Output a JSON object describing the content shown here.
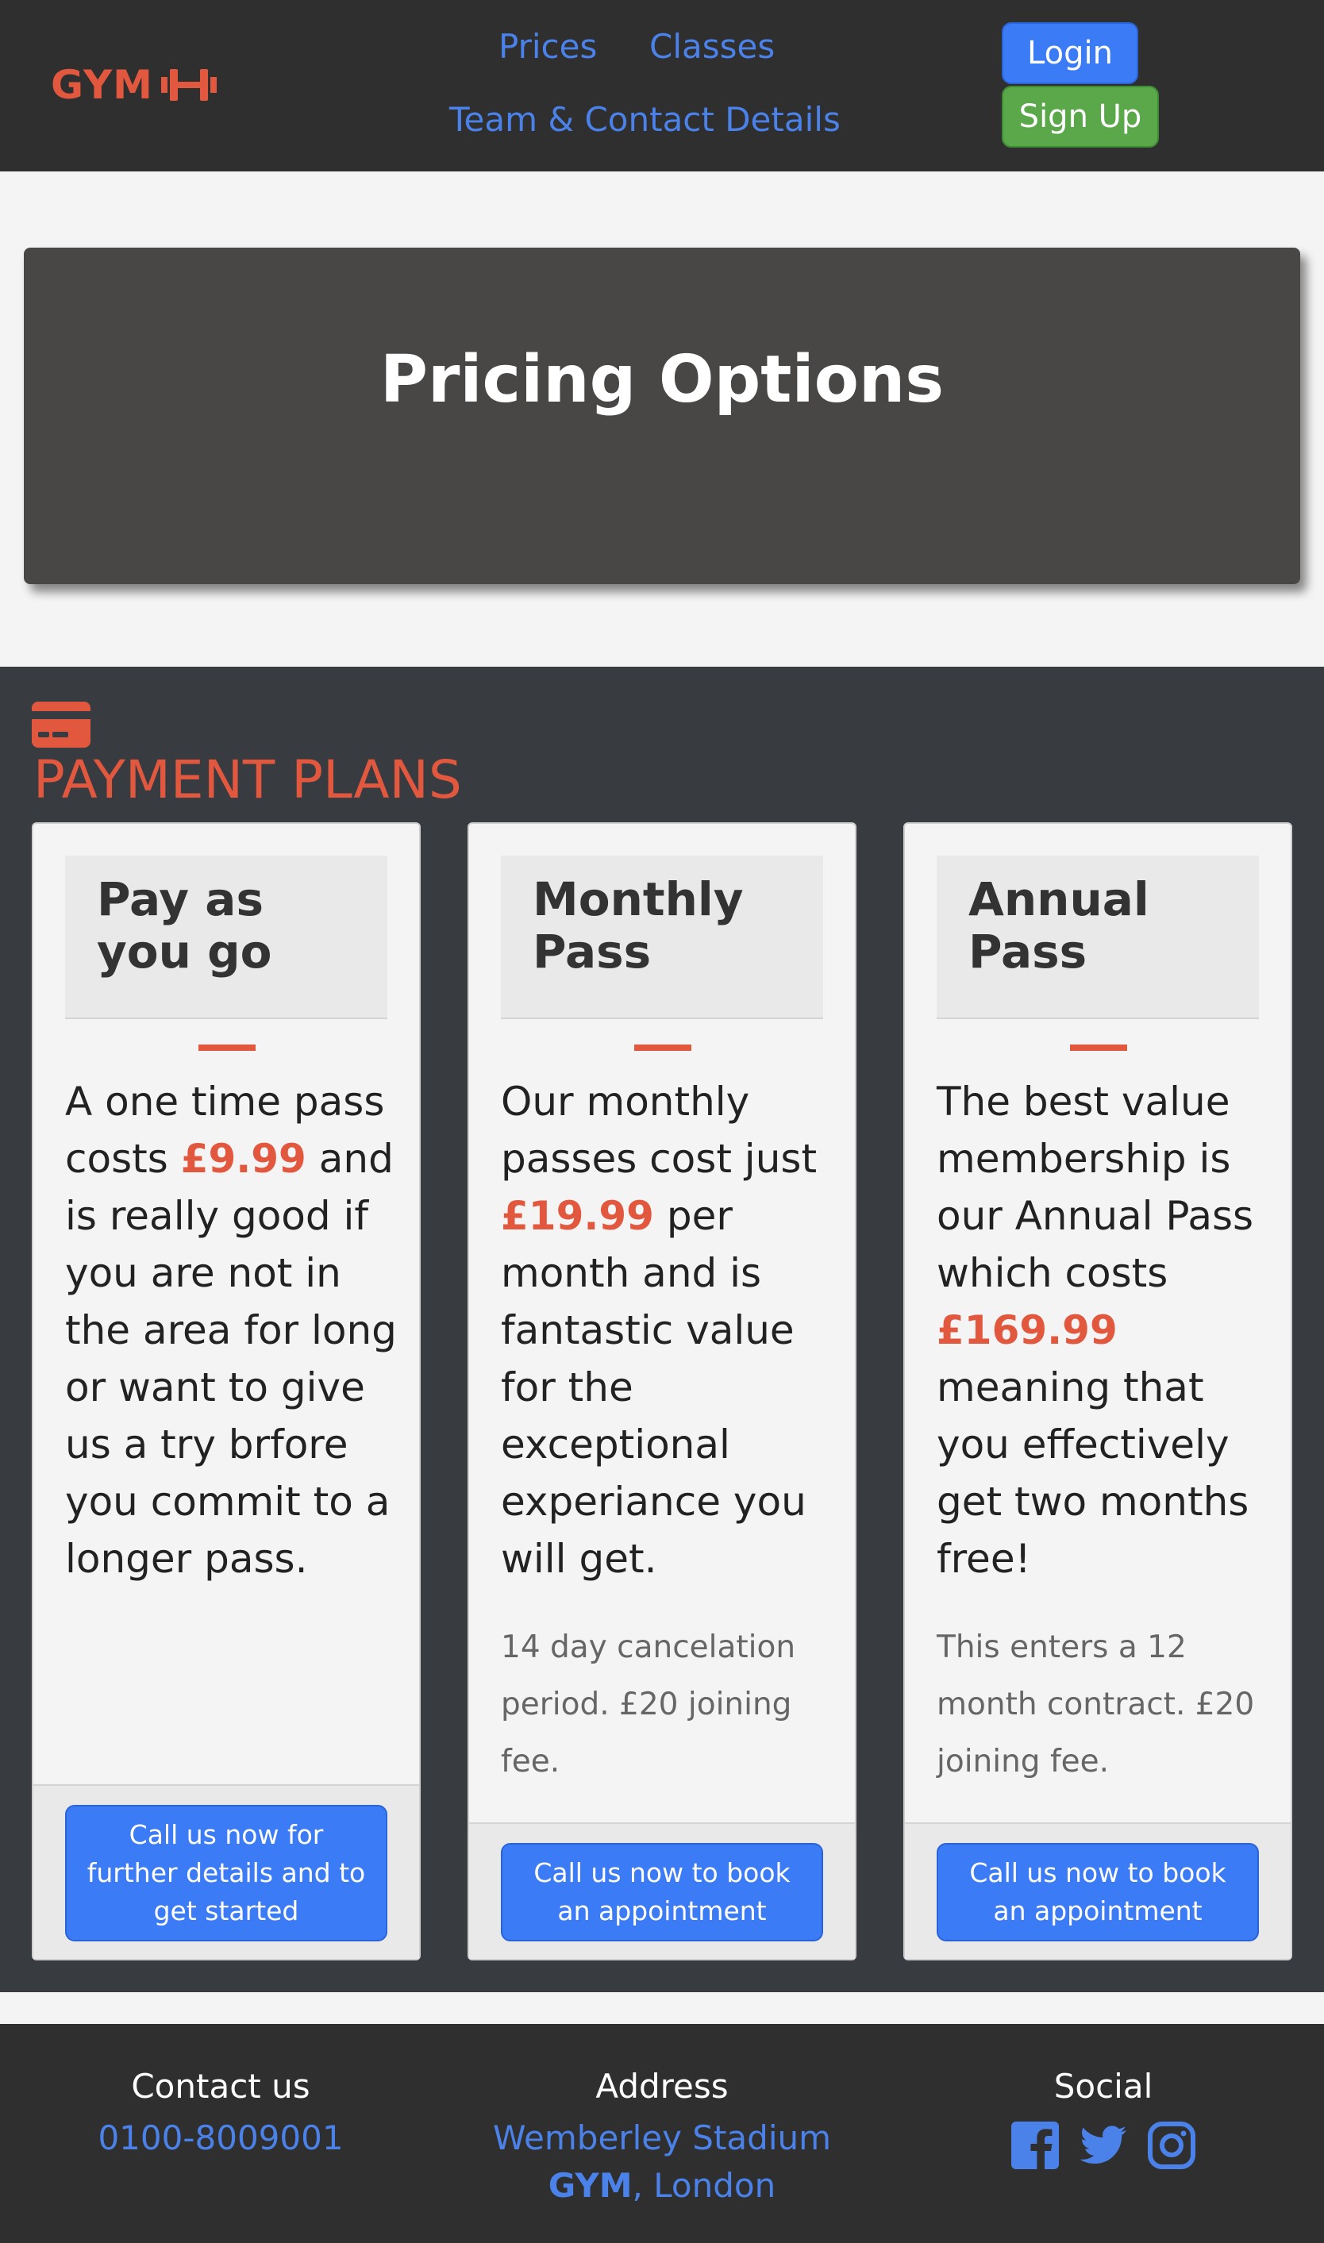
{
  "nav": {
    "brand": "GYM",
    "links": [
      "Prices",
      "Classes",
      "Team & Contact Details"
    ],
    "login": "Login",
    "signup": "Sign Up"
  },
  "hero": {
    "title": "Pricing Options"
  },
  "plans": {
    "title": "PAYMENT PLANS",
    "cards": [
      {
        "title": "Pay as you go",
        "text_before": "A one time pass costs ",
        "price": "£9.99",
        "text_after": " and is really good if you are not in the area for long or want to give us a try brfore you commit to a longer pass.",
        "note": "",
        "button": "Call us now for further details and to get started"
      },
      {
        "title": "Monthly Pass",
        "text_before": "Our monthly passes cost just ",
        "price": "£19.99",
        "text_after": " per month and is fantastic value for the exceptional experiance you will get.",
        "note": "14 day cancelation period. £20 joining fee.",
        "button": "Call us now to book an appointment"
      },
      {
        "title": "Annual Pass",
        "text_before": "The best value membership is our Annual Pass which costs ",
        "price": "£169.99",
        "text_after": " meaning that you effectively get two months free!",
        "note": "This enters a 12 month contract. £20 joining fee.",
        "button": "Call us now to book an appointment"
      }
    ]
  },
  "footer": {
    "contact_heading": "Contact us",
    "phone": "0100-8009001",
    "address_heading": "Address",
    "address_line1": "Wemberley Stadium",
    "address_brand": "GYM",
    "address_rest": ", London",
    "social_heading": "Social",
    "social_icons": [
      "facebook-icon",
      "twitter-icon",
      "instagram-icon"
    ]
  },
  "colors": {
    "accent": "#e2583f",
    "link": "#4b82ea",
    "primary_button": "#3b7bf6",
    "success_button": "#5aa84a",
    "dark": "#2f2f2f"
  }
}
